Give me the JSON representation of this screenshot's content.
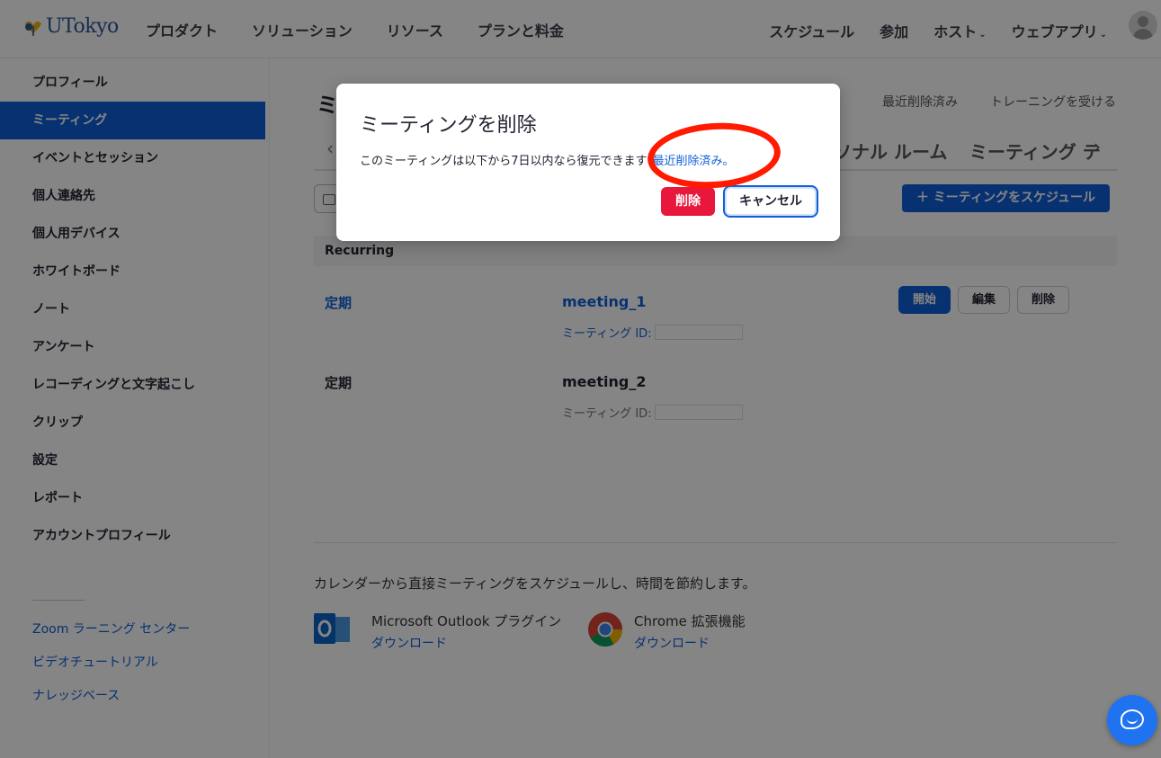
{
  "header": {
    "logo_text": "UTokyo",
    "nav_left": [
      "プロダクト",
      "ソリューション",
      "リソース",
      "プランと料金"
    ],
    "nav_right": {
      "schedule": "スケジュール",
      "join": "参加",
      "host": "ホスト",
      "webapp": "ウェブアプリ"
    }
  },
  "sidebar": {
    "items": [
      {
        "label": "プロフィール"
      },
      {
        "label": "ミーティング",
        "active": true
      },
      {
        "label": "イベントとセッション"
      },
      {
        "label": "個人連絡先"
      },
      {
        "label": "個人用デバイス"
      },
      {
        "label": "ホワイトボード"
      },
      {
        "label": "ノート"
      },
      {
        "label": "アンケート"
      },
      {
        "label": "レコーディングと文字起こし"
      },
      {
        "label": "クリップ"
      },
      {
        "label": "設定"
      },
      {
        "label": "レポート"
      },
      {
        "label": "アカウントプロフィール"
      }
    ],
    "links": [
      "Zoom ラーニング センター",
      "ビデオチュートリアル",
      "ナレッジベース"
    ]
  },
  "main": {
    "title": "ミ",
    "top_links": [
      "最近削除済み",
      "トレーニングを受ける"
    ],
    "tabs": [
      "ソナル ルーム",
      "ミーティング テ"
    ],
    "schedule_button": "＋  ミーティングをスケジュール",
    "section_header": "Recurring",
    "meetings": [
      {
        "type": "定期",
        "title": "meeting_1",
        "id_label": "ミーティング ID:",
        "linked": true,
        "buttons": [
          "開始",
          "編集",
          "削除"
        ]
      },
      {
        "type": "定期",
        "title": "meeting_2",
        "id_label": "ミーティング ID:",
        "linked": false,
        "buttons": []
      }
    ],
    "calendar_text": "カレンダーから直接ミーティングをスケジュールし、時間を節約します。",
    "plugins": [
      {
        "name": "Microsoft Outlook プラグイン",
        "download": "ダウンロード",
        "icon": "outlook-icon"
      },
      {
        "name": "Chrome 拡張機能",
        "download": "ダウンロード",
        "icon": "chrome-icon"
      }
    ]
  },
  "dialog": {
    "title": "ミーティングを削除",
    "message": "このミーティングは以下から7日以内なら復元できます",
    "link": "最近削除済み。",
    "delete_label": "削除",
    "cancel_label": "キャンセル"
  },
  "colors": {
    "brand": "#0e5fd8",
    "danger": "#e8173c",
    "annotation": "#ff1a00"
  }
}
